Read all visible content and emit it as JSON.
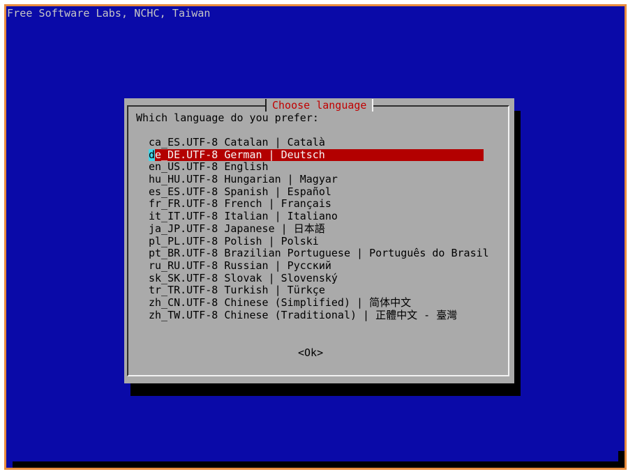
{
  "backtitle": "Free Software Labs, NCHC, Taiwan",
  "dialog": {
    "title": "Choose language",
    "prompt": "Which language do you prefer:",
    "ok_label": "<Ok>"
  },
  "languages": [
    {
      "label": "ca_ES.UTF-8 Catalan | Català",
      "selected": false
    },
    {
      "label": "de_DE.UTF-8 German | Deutsch",
      "selected": true
    },
    {
      "label": "en_US.UTF-8 English",
      "selected": false
    },
    {
      "label": "hu_HU.UTF-8 Hungarian | Magyar",
      "selected": false
    },
    {
      "label": "es_ES.UTF-8 Spanish | Español",
      "selected": false
    },
    {
      "label": "fr_FR.UTF-8 French | Français",
      "selected": false
    },
    {
      "label": "it_IT.UTF-8 Italian | Italiano",
      "selected": false
    },
    {
      "label": "ja_JP.UTF-8 Japanese | 日本語",
      "selected": false
    },
    {
      "label": "pl_PL.UTF-8 Polish | Polski",
      "selected": false
    },
    {
      "label": "pt_BR.UTF-8 Brazilian Portuguese | Português do Brasil",
      "selected": false
    },
    {
      "label": "ru_RU.UTF-8 Russian | Русский",
      "selected": false
    },
    {
      "label": "sk_SK.UTF-8 Slovak | Slovenský",
      "selected": false
    },
    {
      "label": "tr_TR.UTF-8 Turkish | Türkçe",
      "selected": false
    },
    {
      "label": "zh_CN.UTF-8 Chinese (Simplified) | 简体中文",
      "selected": false
    },
    {
      "label": "zh_TW.UTF-8 Chinese (Traditional) | 正體中文 - 臺灣",
      "selected": false
    }
  ],
  "colors": {
    "screen_background": "#0a0aa8",
    "dialog_background": "#aaaaaa",
    "title_color": "#c00000",
    "selection_background": "#b30000",
    "cursor_color": "#43d7ea"
  }
}
